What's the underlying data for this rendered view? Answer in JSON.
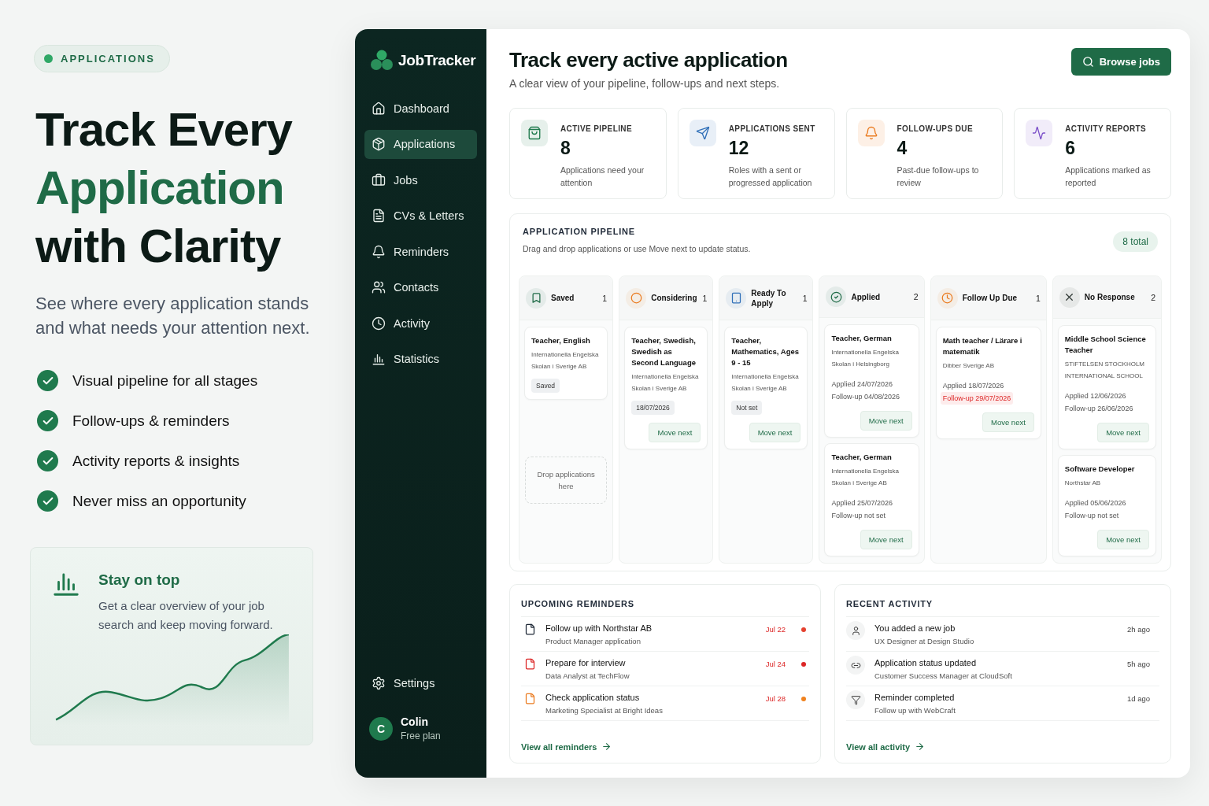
{
  "promo": {
    "badge": "APPLICATIONS",
    "headline": [
      {
        "text": "Track Every",
        "accent": false
      },
      {
        "text": "Application",
        "accent": true
      },
      {
        "text": "with Clarity",
        "accent": false
      }
    ],
    "lead": "See where every application stands and what needs your attention next.",
    "features": [
      "Visual pipeline for all stages",
      "Follow-ups & reminders",
      "Activity reports & insights",
      "Never miss an opportunity"
    ],
    "callout": {
      "title": "Stay on top",
      "text": "Get a clear overview of your job search and keep moving forward."
    }
  },
  "sidebar": {
    "brand": "JobTracker",
    "items": [
      {
        "label": "Dashboard",
        "selected": false
      },
      {
        "label": "Applications",
        "selected": true
      },
      {
        "label": "Jobs",
        "selected": false
      },
      {
        "label": "CVs & Letters",
        "selected": false
      },
      {
        "label": "Reminders",
        "selected": false
      },
      {
        "label": "Contacts",
        "selected": false
      },
      {
        "label": "Activity",
        "selected": false
      },
      {
        "label": "Statistics",
        "selected": false
      }
    ],
    "footer_items": [
      {
        "label": "Settings"
      }
    ],
    "user": {
      "initial": "C",
      "name": "Colin",
      "plan": "Free plan"
    }
  },
  "header": {
    "title": "Track every active application",
    "subtitle": "A clear view of your pipeline, follow-ups and next steps.",
    "action": "Browse jobs"
  },
  "stats": [
    {
      "label": "ACTIVE PIPELINE",
      "value": "8",
      "note": "Applications need your attention"
    },
    {
      "label": "APPLICATIONS SENT",
      "value": "12",
      "note": "Roles with a sent or progressed application"
    },
    {
      "label": "FOLLOW-UPS DUE",
      "value": "4",
      "note": "Past-due follow-ups to review"
    },
    {
      "label": "ACTIVITY REPORTS",
      "value": "6",
      "note": "Applications marked as reported"
    }
  ],
  "pipeline": {
    "title": "APPLICATION PIPELINE",
    "subtitle": "Drag and drop applications or use Move next to update status.",
    "total": "8 total",
    "columns": [
      {
        "name": "Saved",
        "count": "1",
        "dropzone": "Drop applications here",
        "cards": [
          {
            "title": "Teacher, English",
            "company": "Internationella Engelska Skolan i Sverige AB",
            "tag": "Saved"
          }
        ]
      },
      {
        "name": "Considering",
        "count": "1",
        "cards": [
          {
            "title": "Teacher, Swedish, Swedish as Second Language",
            "company": "Internationella Engelska Skolan i Sverige AB",
            "tag": "18/07/2026",
            "action": "Move next"
          }
        ]
      },
      {
        "name": "Ready To Apply",
        "count": "1",
        "cards": [
          {
            "title": "Teacher, Mathematics, Ages 9 - 15",
            "company": "Internationella Engelska Skolan i Sverige AB",
            "tag": "Not set",
            "action": "Move next"
          }
        ]
      },
      {
        "name": "Applied",
        "count": "2",
        "cards": [
          {
            "title": "Teacher, German",
            "company": "Internationella Engelska Skolan i Helsingborg",
            "applied": "Applied 24/07/2026",
            "followup": "Follow-up 04/08/2026",
            "overdue": false,
            "action": "Move next"
          },
          {
            "title": "Teacher, German",
            "company": "Internationella Engelska Skolan i Sverige AB",
            "applied": "Applied 25/07/2026",
            "followup": "Follow-up not set",
            "overdue": false,
            "action": "Move next"
          }
        ]
      },
      {
        "name": "Follow Up Due",
        "count": "1",
        "cards": [
          {
            "title": "Math teacher / Lärare i matematik",
            "company": "Dibber Sverige AB",
            "applied": "Applied 18/07/2026",
            "followup": "Follow-up 29/07/2026",
            "overdue": true,
            "action": "Move next"
          }
        ]
      },
      {
        "name": "No Response",
        "count": "2",
        "cards": [
          {
            "title": "Middle School Science Teacher",
            "company": "STIFTELSEN STOCKHOLM INTERNATIONAL SCHOOL",
            "applied": "Applied 12/06/2026",
            "followup": "Follow-up 26/06/2026",
            "overdue": false,
            "action": "Move next"
          },
          {
            "title": "Software Developer",
            "company": "Northstar AB",
            "applied": "Applied 05/06/2026",
            "followup": "Follow-up not set",
            "overdue": false,
            "action": "Move next"
          }
        ]
      }
    ]
  },
  "reminders": {
    "title": "UPCOMING REMINDERS",
    "link": "View all reminders",
    "items": [
      {
        "title": "Follow up with Northstar AB",
        "subtitle": "Product Manager application",
        "date": "Jul 22",
        "color": "#e5412f"
      },
      {
        "title": "Prepare for interview",
        "subtitle": "Data Analyst at TechFlow",
        "date": "Jul 24",
        "color": "#dc2626"
      },
      {
        "title": "Check application status",
        "subtitle": "Marketing Specialist at Bright Ideas",
        "date": "Jul 28",
        "color": "#f0821e"
      }
    ]
  },
  "activity": {
    "title": "RECENT ACTIVITY",
    "link": "View all activity",
    "items": [
      {
        "title": "You added a new job",
        "subtitle": "UX Designer at Design Studio",
        "time": "2h ago"
      },
      {
        "title": "Application status updated",
        "subtitle": "Customer Success Manager at CloudSoft",
        "time": "5h ago"
      },
      {
        "title": "Reminder completed",
        "subtitle": "Follow up with WebCraft",
        "time": "1d ago"
      }
    ]
  }
}
